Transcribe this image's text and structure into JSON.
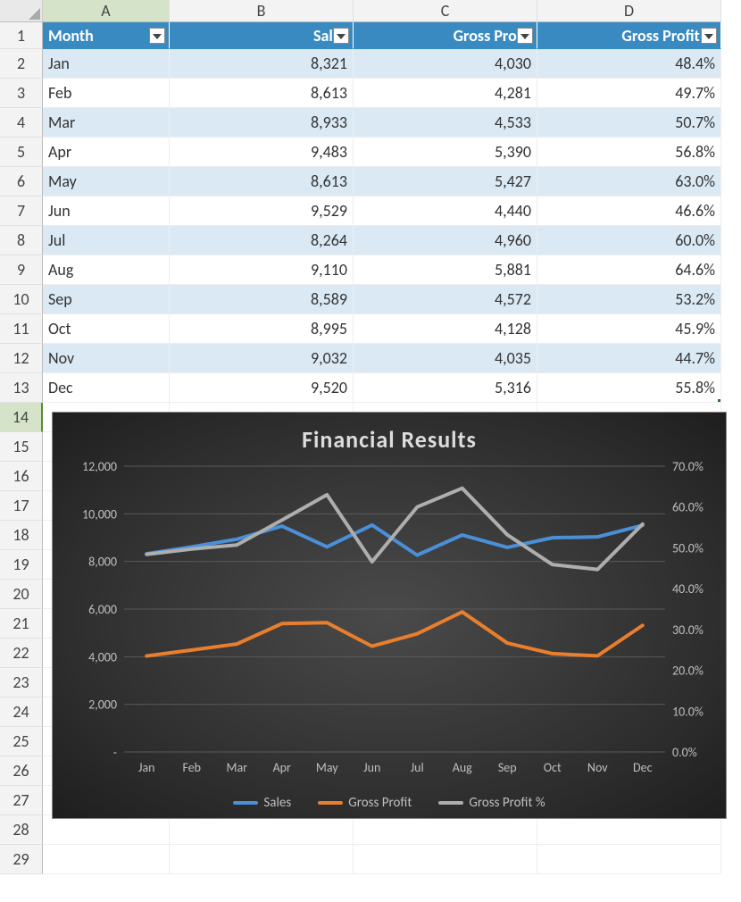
{
  "columns": [
    "A",
    "B",
    "C",
    "D"
  ],
  "table": {
    "headers": [
      "Month",
      "Sales",
      "Gross Profit",
      "Gross Profit %"
    ],
    "rows": [
      {
        "m": "Jan",
        "s": "8,321",
        "g": "4,030",
        "p": "48.4%",
        "sv": 8321,
        "gv": 4030,
        "pv": 48.4
      },
      {
        "m": "Feb",
        "s": "8,613",
        "g": "4,281",
        "p": "49.7%",
        "sv": 8613,
        "gv": 4281,
        "pv": 49.7
      },
      {
        "m": "Mar",
        "s": "8,933",
        "g": "4,533",
        "p": "50.7%",
        "sv": 8933,
        "gv": 4533,
        "pv": 50.7
      },
      {
        "m": "Apr",
        "s": "9,483",
        "g": "5,390",
        "p": "56.8%",
        "sv": 9483,
        "gv": 5390,
        "pv": 56.8
      },
      {
        "m": "May",
        "s": "8,613",
        "g": "5,427",
        "p": "63.0%",
        "sv": 8613,
        "gv": 5427,
        "pv": 63.0
      },
      {
        "m": "Jun",
        "s": "9,529",
        "g": "4,440",
        "p": "46.6%",
        "sv": 9529,
        "gv": 4440,
        "pv": 46.6
      },
      {
        "m": "Jul",
        "s": "8,264",
        "g": "4,960",
        "p": "60.0%",
        "sv": 8264,
        "gv": 4960,
        "pv": 60.0
      },
      {
        "m": "Aug",
        "s": "9,110",
        "g": "5,881",
        "p": "64.6%",
        "sv": 9110,
        "gv": 5881,
        "pv": 64.6
      },
      {
        "m": "Sep",
        "s": "8,589",
        "g": "4,572",
        "p": "53.2%",
        "sv": 8589,
        "gv": 4572,
        "pv": 53.2
      },
      {
        "m": "Oct",
        "s": "8,995",
        "g": "4,128",
        "p": "45.9%",
        "sv": 8995,
        "gv": 4128,
        "pv": 45.9
      },
      {
        "m": "Nov",
        "s": "9,032",
        "g": "4,035",
        "p": "44.7%",
        "sv": 9032,
        "gv": 4035,
        "pv": 44.7
      },
      {
        "m": "Dec",
        "s": "9,520",
        "g": "5,316",
        "p": "55.8%",
        "sv": 9520,
        "gv": 5316,
        "pv": 55.8
      }
    ]
  },
  "chart_data": {
    "type": "line",
    "title": "Financial Results",
    "categories": [
      "Jan",
      "Feb",
      "Mar",
      "Apr",
      "May",
      "Jun",
      "Jul",
      "Aug",
      "Sep",
      "Oct",
      "Nov",
      "Dec"
    ],
    "y1": {
      "min": 0,
      "max": 12000,
      "step": 2000,
      "ticks": [
        "-",
        "2,000",
        "4,000",
        "6,000",
        "8,000",
        "10,000",
        "12,000"
      ]
    },
    "y2": {
      "min": 0,
      "max": 70,
      "step": 10,
      "ticks": [
        "0.0%",
        "10.0%",
        "20.0%",
        "30.0%",
        "40.0%",
        "50.0%",
        "60.0%",
        "70.0%"
      ]
    },
    "series": [
      {
        "name": "Sales",
        "axis": "y1",
        "color": "#4a90d9",
        "values": [
          8321,
          8613,
          8933,
          9483,
          8613,
          9529,
          8264,
          9110,
          8589,
          8995,
          9032,
          9520
        ]
      },
      {
        "name": "Gross Profit",
        "axis": "y1",
        "color": "#e97e2e",
        "values": [
          4030,
          4281,
          4533,
          5390,
          5427,
          4440,
          4960,
          5881,
          4572,
          4128,
          4035,
          5316
        ]
      },
      {
        "name": "Gross Profit %",
        "axis": "y2",
        "color": "#aeaeae",
        "values": [
          48.4,
          49.7,
          50.7,
          56.8,
          63.0,
          46.6,
          60.0,
          64.6,
          53.2,
          45.9,
          44.7,
          55.8
        ]
      }
    ]
  },
  "total_rows": 29
}
